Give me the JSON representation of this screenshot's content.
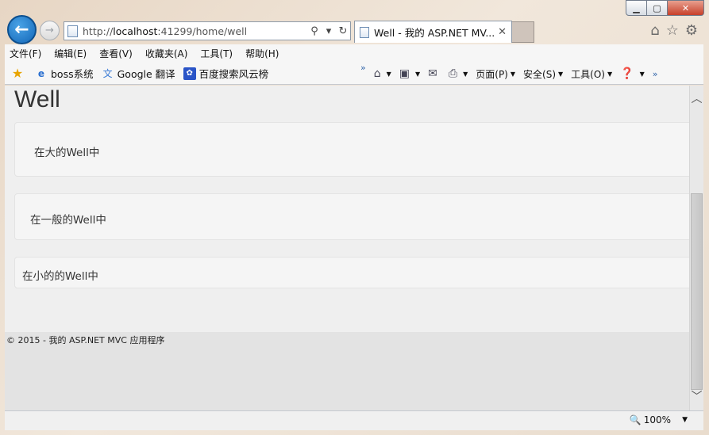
{
  "window": {
    "minimize_icon": "minimize-icon",
    "maximize_icon": "maximize-icon",
    "close_icon": "close-icon"
  },
  "address_bar": {
    "url_prefix": "http://",
    "url_host": "localhost",
    "url_rest": ":41299/home/well"
  },
  "tab": {
    "title": "Well - 我的 ASP.NET MV...",
    "close_glyph": "✕"
  },
  "menu": [
    "文件(F)",
    "编辑(E)",
    "查看(V)",
    "收藏夹(A)",
    "工具(T)",
    "帮助(H)"
  ],
  "favorites": [
    "boss系统",
    "Google 翻译",
    "百度搜索风云榜"
  ],
  "command_bar": {
    "page": "页面(P)",
    "safety": "安全(S)",
    "tools": "工具(O)"
  },
  "page": {
    "title": "Well",
    "well_large": "在大的Well中",
    "well_medium": "在一般的Well中",
    "well_small": "在小的的Well中",
    "footer": "© 2015 - 我的 ASP.NET MVC 应用程序"
  },
  "status": {
    "zoom": "100%"
  },
  "colors": {
    "back_button": "#1367b8",
    "close_button": "#c7402a",
    "page_bg": "#efefef",
    "well_bg": "#f5f5f5"
  }
}
